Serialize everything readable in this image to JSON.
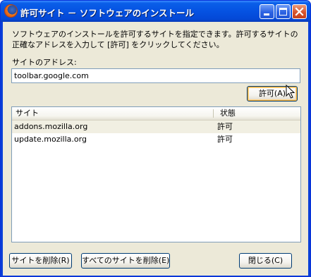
{
  "window": {
    "title": "許可サイト － ソフトウェアのインストール"
  },
  "description": "ソフトウェアのインストールを許可するサイトを指定できます。許可するサイトの正確なアドレスを入力して [許可] をクリックしてください。",
  "address": {
    "label": "サイトのアドレス:",
    "value": "toolbar.google.com"
  },
  "allow_button": "許可(A)",
  "list": {
    "headers": [
      "サイト",
      "状態"
    ],
    "rows": [
      {
        "site": "addons.mozilla.org",
        "status": "許可"
      },
      {
        "site": "update.mozilla.org",
        "status": "許可"
      }
    ]
  },
  "footer": {
    "remove_site": "サイトを削除(R)",
    "remove_all": "すべてのサイトを削除(E)",
    "close": "閉じる(C)"
  }
}
